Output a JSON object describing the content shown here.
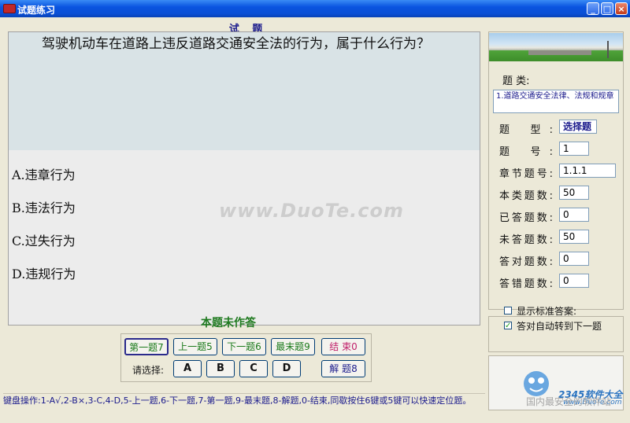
{
  "window": {
    "title": "试题练习",
    "buttons": {
      "minimize": "_",
      "maximize": "□",
      "close": "×"
    }
  },
  "question": {
    "section_label": "试 题",
    "text": "驾驶机动车在道路上违反道路交通安全法的行为，属于什么行为？",
    "options": [
      "A.违章行为",
      "B.违法行为",
      "C.过失行为",
      "D.违规行为"
    ]
  },
  "watermark": "www.DuoTe.com",
  "status": "本题未作答",
  "nav": {
    "first": "第一题7",
    "prev": "上一题5",
    "next": "下一题6",
    "last": "最末题9",
    "end": "结 束0",
    "explain": "解 题8",
    "choose_label": "请选择:",
    "choices": [
      "A",
      "B",
      "C",
      "D"
    ]
  },
  "info": {
    "category_label": "题 类:",
    "category_value": "1.道路交通安全法律、法规和规章",
    "type_label": "题 型:",
    "type_value": "选择题",
    "number_label": "题 号:",
    "number_value": "1",
    "chapter_label": "章节题号:",
    "chapter_value": "1.1.1",
    "total_label": "本类题数:",
    "total_value": "50",
    "answered_label": "已答题数:",
    "answered_value": "0",
    "unanswered_label": "未答题数:",
    "unanswered_value": "50",
    "correct_label": "答对题数:",
    "correct_value": "0",
    "wrong_label": "答错题数:",
    "wrong_value": "0"
  },
  "options_panel": {
    "show_answer_label": "显示标准答案:",
    "show_answer_checked": false,
    "auto_next_label": "答对自动转到下一题",
    "auto_next_checked": true
  },
  "logo": {
    "brand": "2345软件大全",
    "url": "www.DuoTe.com",
    "tagline": "国内最安全的软件站"
  },
  "help_text": "键盘操作:1-A√,2-B×,3-C,4-D,5-上一题,6-下一题,7-第一题,9-最末题,8-解题,0-结束,同歇按住6键或5键可以快速定位题。"
}
